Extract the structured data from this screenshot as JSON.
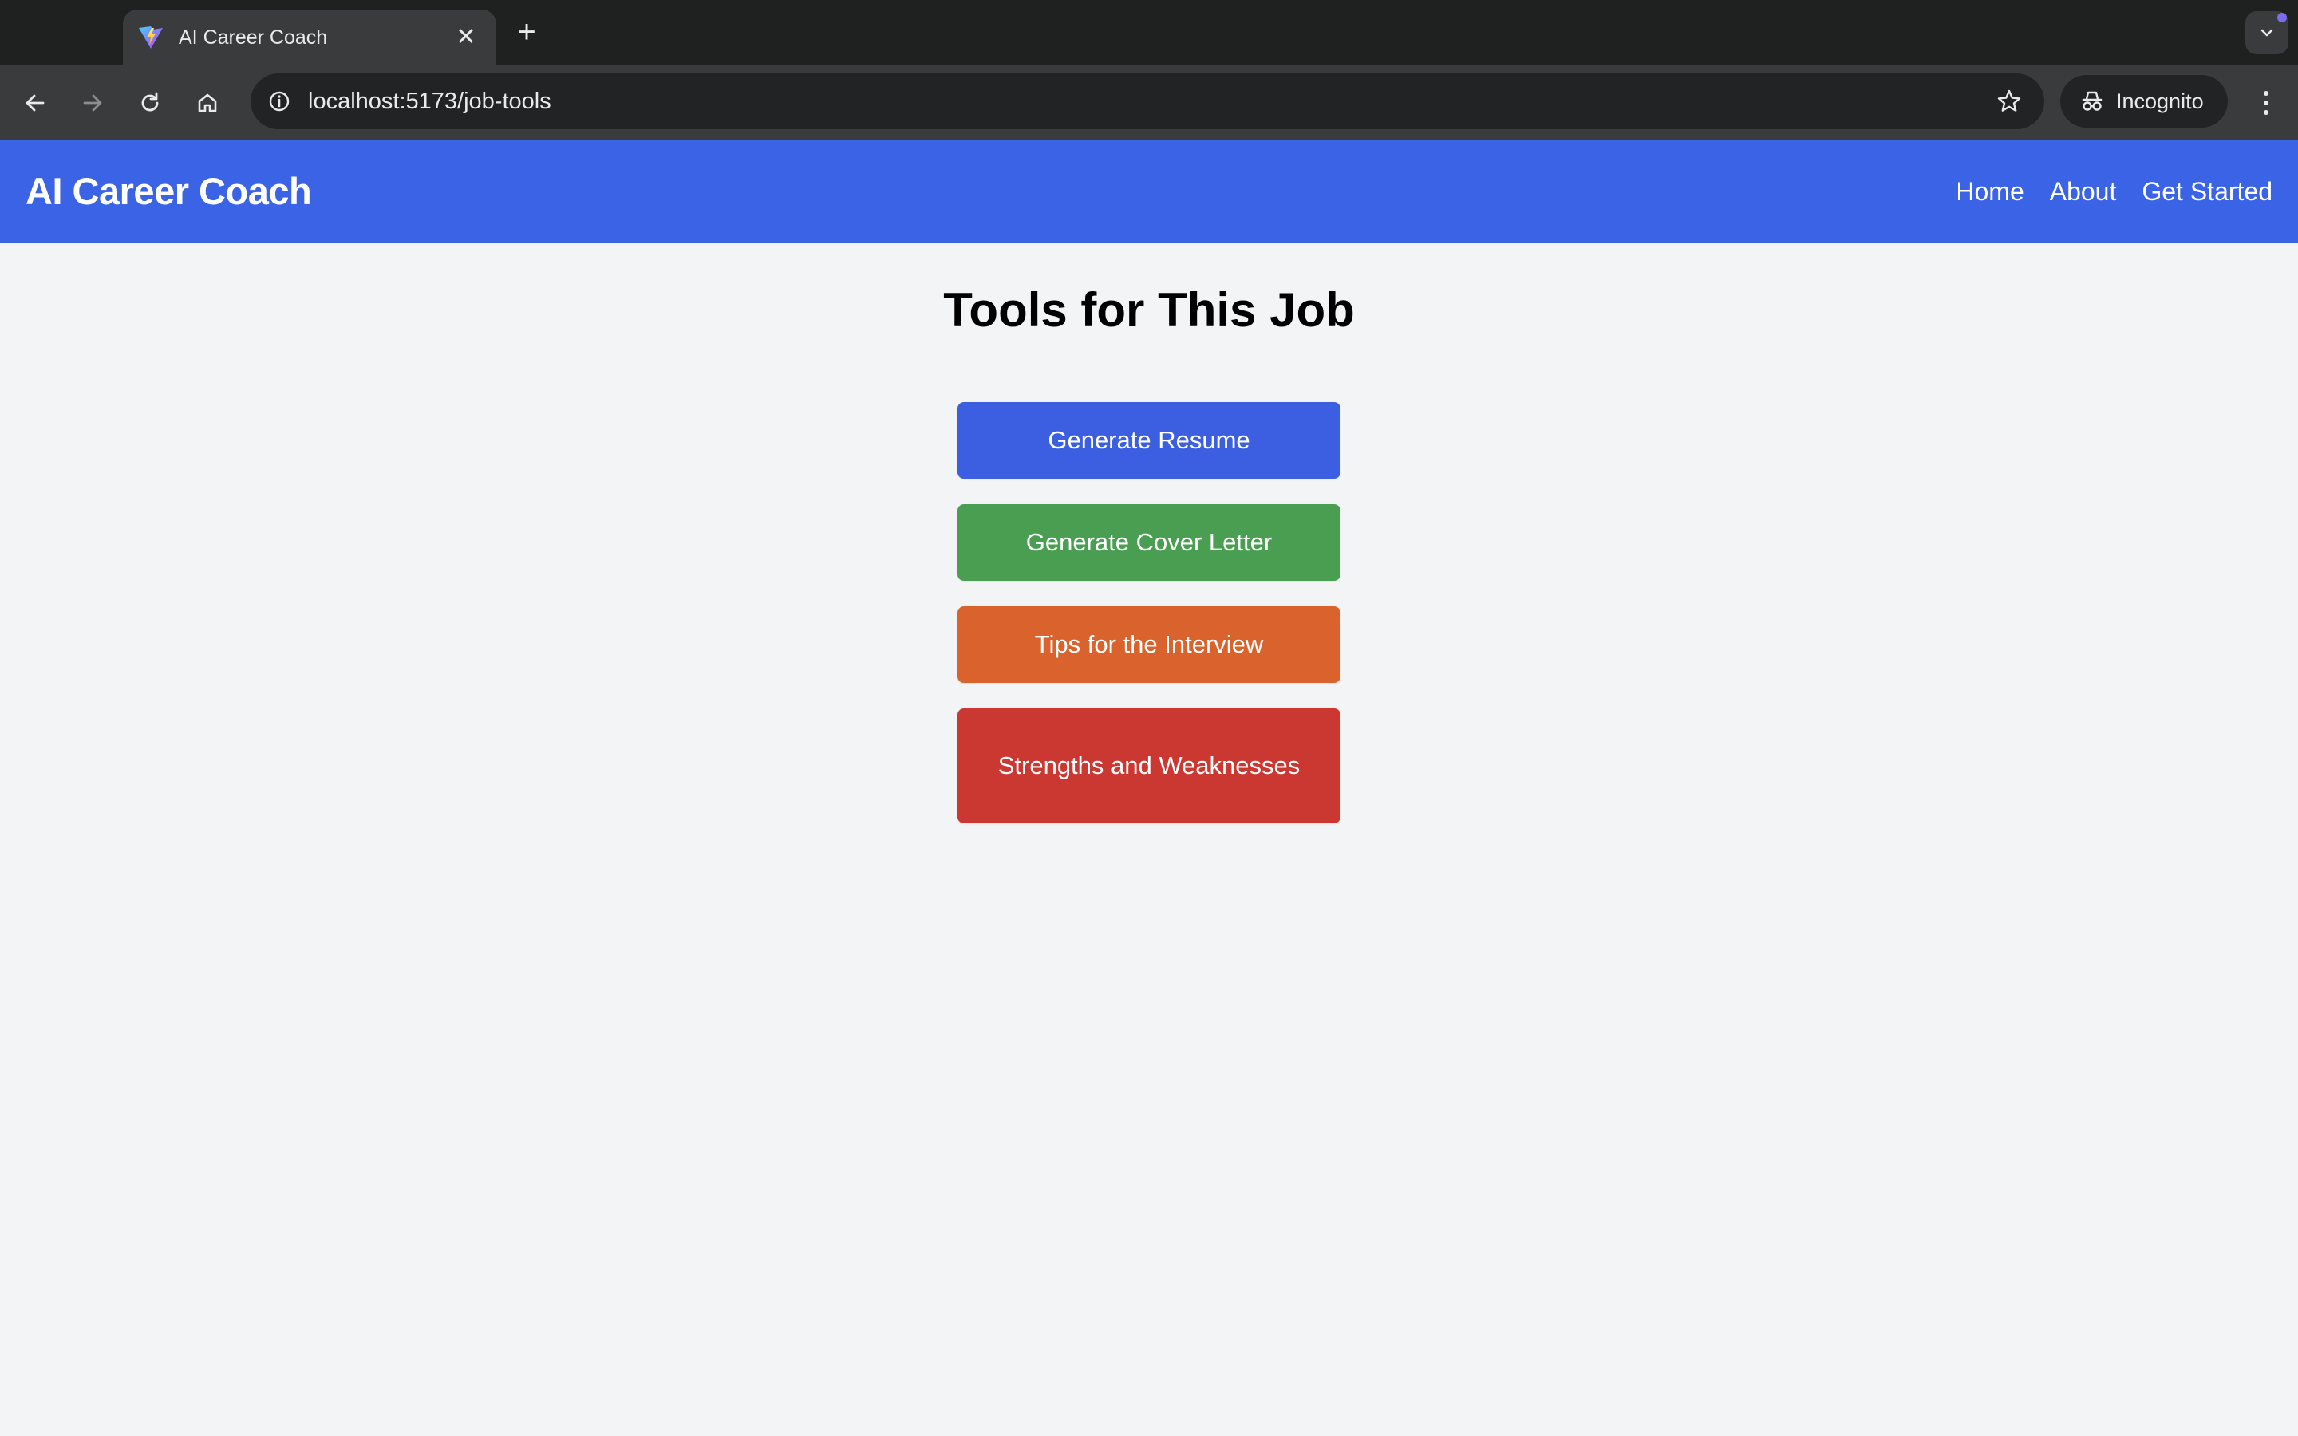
{
  "browser": {
    "tab": {
      "title": "AI Career Coach",
      "close_glyph": "✕"
    },
    "new_tab_glyph": "+",
    "address": {
      "url": "localhost:5173/job-tools"
    },
    "profile": {
      "label": "Incognito"
    },
    "icons": [
      "vite-favicon-icon",
      "back-icon",
      "forward-icon",
      "reload-icon",
      "home-icon",
      "site-info-icon",
      "bookmark-star-icon",
      "incognito-icon",
      "menu-kebab-icon",
      "tab-search-chevron-icon"
    ]
  },
  "navbar": {
    "brand": "AI Career Coach",
    "links": [
      "Home",
      "About",
      "Get Started"
    ],
    "color": "#3b63e6"
  },
  "main": {
    "title": "Tools for This Job",
    "buttons": [
      {
        "label": "Generate Resume",
        "color": "#3b5fe0"
      },
      {
        "label": "Generate Cover Letter",
        "color": "#4a9e52"
      },
      {
        "label": "Tips for the Interview",
        "color": "#da632d"
      },
      {
        "label": "Strengths and Weaknesses",
        "color": "#cb3731"
      }
    ]
  }
}
